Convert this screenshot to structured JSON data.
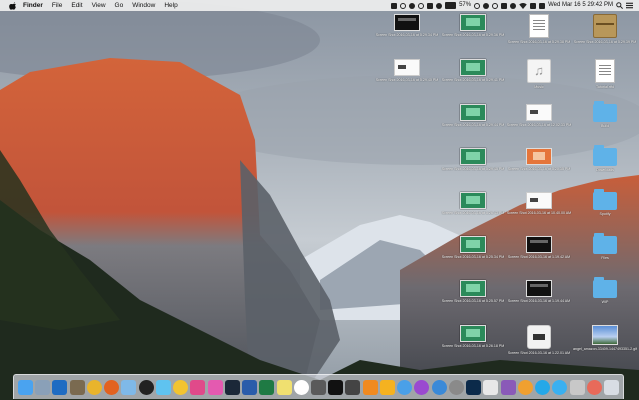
{
  "menubar": {
    "app_name": "Finder",
    "menus": [
      "File",
      "Edit",
      "View",
      "Go",
      "Window",
      "Help"
    ],
    "battery_percent": "57%",
    "clock": "Wed Mar 16  5 29:42 PM"
  },
  "desktop_icons": [
    {
      "col": 0,
      "row": 0,
      "label": "Screen Shot 2016-03-16 at 5.29.34 PM",
      "kind": "dark-window"
    },
    {
      "col": 1,
      "row": 0,
      "label": "Screen Shot 2016-03-16 at 5.29.36 PM",
      "kind": "screenshot"
    },
    {
      "col": 2,
      "row": 0,
      "label": "Screen Shot 2016-03-16 at 5.29.38 PM",
      "kind": "document"
    },
    {
      "col": 3,
      "row": 0,
      "label": "Screen Shot 2016-03-16 at 5.29.39 PM",
      "kind": "archive"
    },
    {
      "col": 0,
      "row": 1,
      "label": "Screen Shot 2016-03-16 at 5.29.40 PM",
      "kind": "white-window"
    },
    {
      "col": 1,
      "row": 1,
      "label": "Screen Shot 2016-03-16 at 5.29.41 PM",
      "kind": "screenshot"
    },
    {
      "col": 2,
      "row": 1,
      "label": "Music",
      "kind": "music"
    },
    {
      "col": 3,
      "row": 1,
      "label": "Tutorial.rtfd",
      "kind": "document"
    },
    {
      "col": 1,
      "row": 2,
      "label": "Screen Shot 2016-03-16 at 5.29.44 PM",
      "kind": "screenshot"
    },
    {
      "col": 2,
      "row": 2,
      "label": "Screen Shot 2016-03-16 at 12.02.33 PM",
      "kind": "white-window"
    },
    {
      "col": 3,
      "row": 2,
      "label": "Build",
      "kind": "folder"
    },
    {
      "col": 1,
      "row": 3,
      "label": "Screen Shot 2016-03-16 at 5.29.45 PM",
      "kind": "screenshot"
    },
    {
      "col": 2,
      "row": 3,
      "label": "Screen Shot 2016-03-16 at 5.20.35 PM",
      "kind": "orange-window"
    },
    {
      "col": 3,
      "row": 3,
      "label": "Downloads",
      "kind": "folder"
    },
    {
      "col": 1,
      "row": 4,
      "label": "Screen Shot 2016-03-16 at 5.26.43 PM",
      "kind": "screenshot"
    },
    {
      "col": 2,
      "row": 4,
      "label": "Screen Shot 2016-03-16 at 10.40.00 AM",
      "kind": "white-window"
    },
    {
      "col": 3,
      "row": 4,
      "label": "Spotify",
      "kind": "folder"
    },
    {
      "col": 1,
      "row": 5,
      "label": "Screen Shot 2016-03-16 at 5.25.34 PM",
      "kind": "screenshot"
    },
    {
      "col": 2,
      "row": 5,
      "label": "Screen Shot 2016-03-16 at 1.19.42 AM",
      "kind": "dark-window"
    },
    {
      "col": 3,
      "row": 5,
      "label": "Files",
      "kind": "folder"
    },
    {
      "col": 1,
      "row": 6,
      "label": "Screen Shot 2016-03-16 at 5.25.57 PM",
      "kind": "screenshot"
    },
    {
      "col": 2,
      "row": 6,
      "label": "Screen Shot 2016-03-16 at 1.19.44 AM",
      "kind": "dark-window"
    },
    {
      "col": 3,
      "row": 6,
      "label": "WIP",
      "kind": "folder"
    },
    {
      "col": 1,
      "row": 7,
      "label": "Screen Shot 2016-03-16 at 5.26.18 PM",
      "kind": "screenshot"
    },
    {
      "col": 2,
      "row": 7,
      "label": "Screen Shot 2016-03-16 at 1.22.01 AM",
      "kind": "app"
    },
    {
      "col": 3,
      "row": 7,
      "label": "angel_amazon-33409-1447493351-2.gif",
      "kind": "photo"
    }
  ],
  "dock_apps": [
    {
      "name": "finder-icon",
      "color": "#4aa3f0"
    },
    {
      "name": "launchpad-icon",
      "color": "#8aa0b8"
    },
    {
      "name": "outlook-icon",
      "color": "#1f6cc2"
    },
    {
      "name": "preview-icon",
      "color": "#7a6a50"
    },
    {
      "name": "chrome-icon",
      "color": "#e9b42c",
      "round": true
    },
    {
      "name": "firefox-icon",
      "color": "#e2621f",
      "round": true
    },
    {
      "name": "mail-icon",
      "color": "#7fb9e8"
    },
    {
      "name": "bbedit-icon",
      "color": "#222222",
      "round": true
    },
    {
      "name": "messages-icon",
      "color": "#5fc3f0"
    },
    {
      "name": "tips-icon",
      "color": "#f2c430",
      "round": true
    },
    {
      "name": "photos-icon",
      "color": "#e04a8a"
    },
    {
      "name": "itunes-icon",
      "color": "#e45ab0"
    },
    {
      "name": "steam-icon",
      "color": "#1b2838"
    },
    {
      "name": "word-icon",
      "color": "#2a5caa"
    },
    {
      "name": "excel-icon",
      "color": "#1f7a44"
    },
    {
      "name": "notes-icon",
      "color": "#f0e070"
    },
    {
      "name": "spotify-icon",
      "color": "#ffffff",
      "round": true
    },
    {
      "name": "movie-icon",
      "color": "#5a5a5a"
    },
    {
      "name": "stocks-icon",
      "color": "#111111"
    },
    {
      "name": "tidal-icon",
      "color": "#444444"
    },
    {
      "name": "vlc-icon",
      "color": "#f08a20"
    },
    {
      "name": "sketch-icon",
      "color": "#f5b220"
    },
    {
      "name": "safari-icon",
      "color": "#4aa0e8",
      "round": true
    },
    {
      "name": "podcasts-icon",
      "color": "#9a4ad0",
      "round": true
    },
    {
      "name": "globe-icon",
      "color": "#3a8ad8",
      "round": true
    },
    {
      "name": "settings-icon",
      "color": "#8a8a8a",
      "round": true
    },
    {
      "name": "photoshop-icon",
      "color": "#0b2a4a"
    },
    {
      "name": "textedit-icon",
      "color": "#e8e8e8"
    },
    {
      "name": "books-icon",
      "color": "#8a5ab8"
    },
    {
      "name": "headphones-icon",
      "color": "#f0a030",
      "round": true
    },
    {
      "name": "skype-icon",
      "color": "#25a8e8",
      "round": true
    },
    {
      "name": "messenger-icon",
      "color": "#3ab0f0",
      "round": true
    },
    {
      "name": "utility-icon",
      "color": "#c8c8c8"
    },
    {
      "name": "color-picker-icon",
      "color": "#e86a5a",
      "round": true
    },
    {
      "name": "trash-icon",
      "color": "#d8dde4"
    }
  ]
}
